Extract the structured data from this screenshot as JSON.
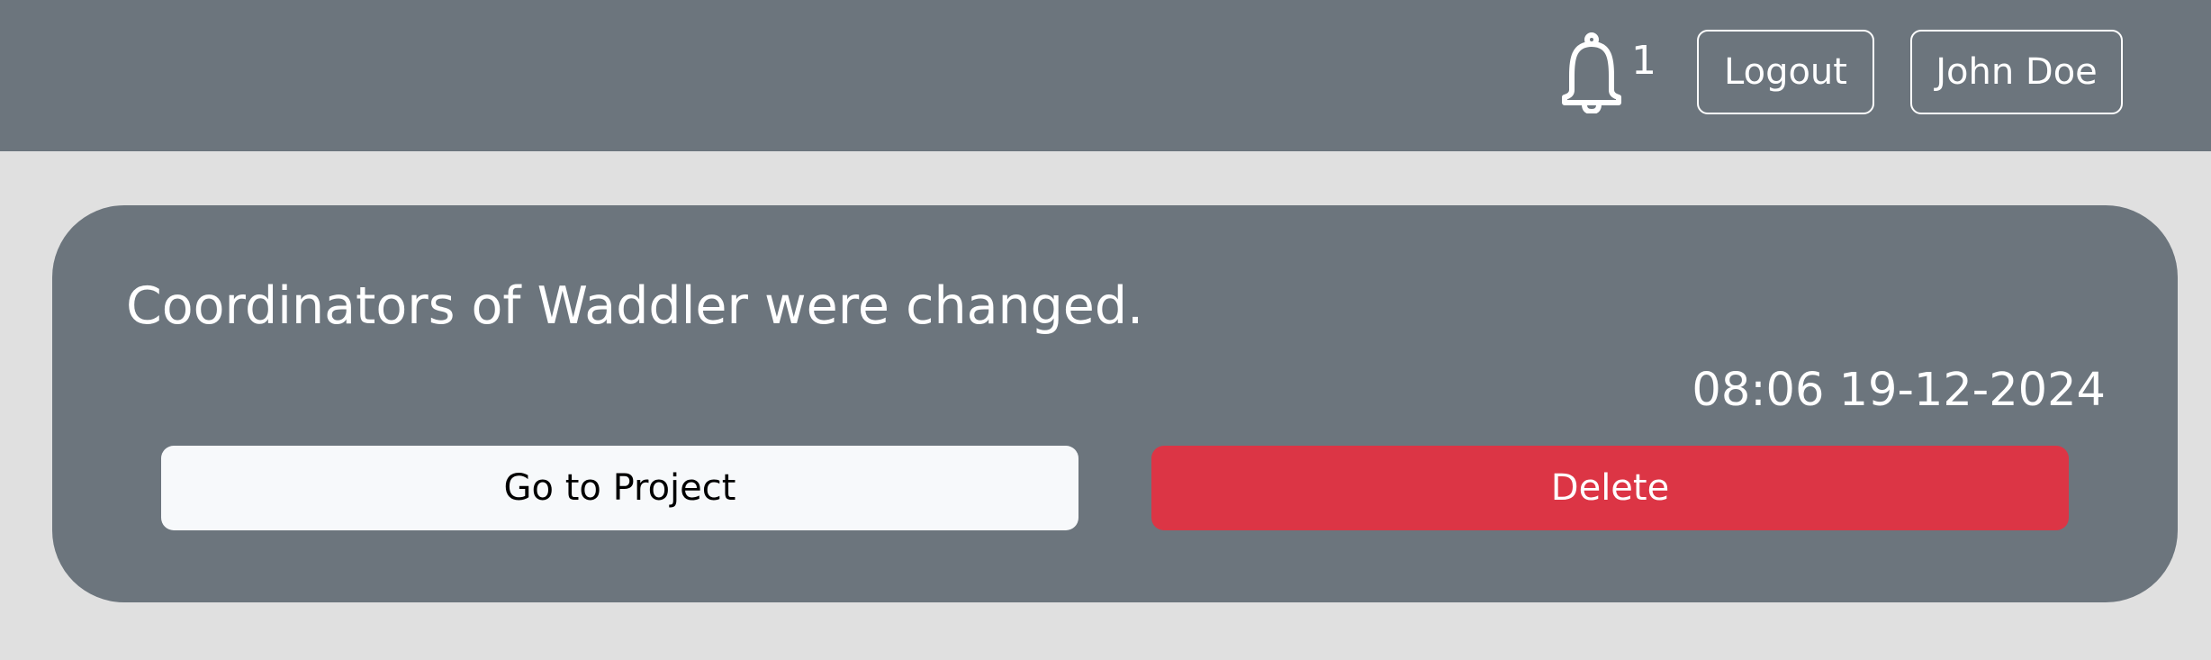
{
  "header": {
    "notification_icon": "bell-icon",
    "notification_count": "1",
    "logout_label": "Logout",
    "user_name": "John Doe"
  },
  "notification": {
    "message": "Coordinators of Waddler were changed.",
    "timestamp": "08:06 19-12-2024",
    "go_to_project_label": "Go to Project",
    "delete_label": "Delete"
  },
  "colors": {
    "page_background": "#e0e0e0",
    "bar_and_card": "#6c757d",
    "primary_button": "#f7f9fb",
    "danger_button": "#dc3545",
    "text_light": "#ffffff"
  }
}
